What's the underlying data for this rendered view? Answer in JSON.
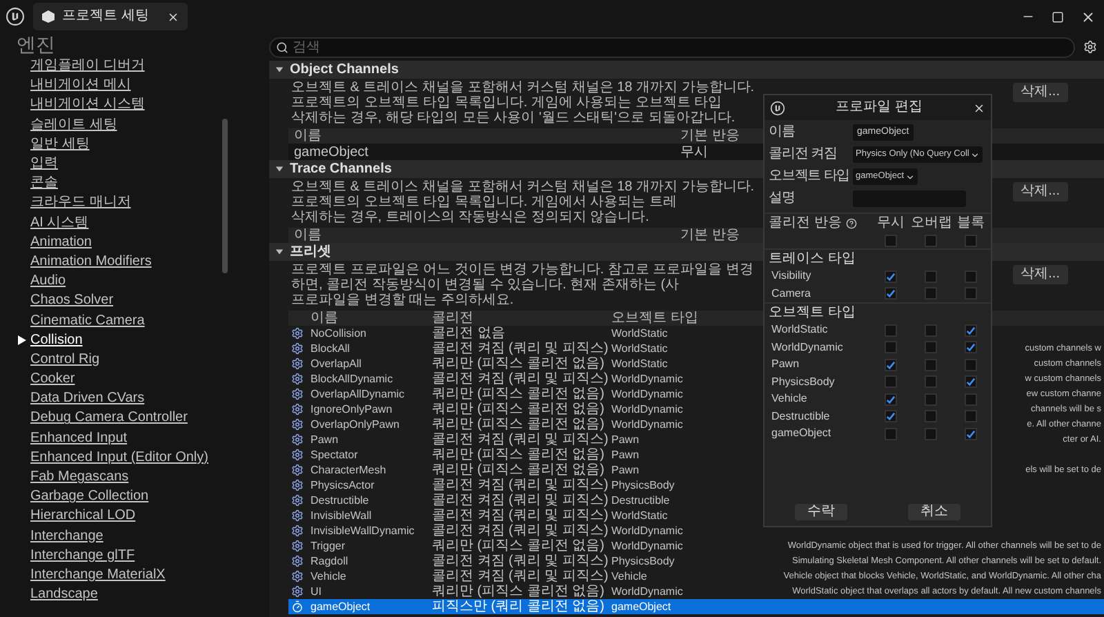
{
  "window": {
    "title": "프로젝트 세팅"
  },
  "sidebar": {
    "heading": "엔진",
    "items": [
      {
        "label": "게임플레이 디버거",
        "selected": false
      },
      {
        "label": "내비게이션 메시",
        "selected": false
      },
      {
        "label": "내비게이션 시스템",
        "selected": false
      },
      {
        "label": "슬레이트 세팅",
        "selected": false
      },
      {
        "label": "일반 세팅",
        "selected": false
      },
      {
        "label": "입력",
        "selected": false
      },
      {
        "label": "콘솔",
        "selected": false
      },
      {
        "label": "크라우드 매니저",
        "selected": false
      },
      {
        "label": "AI 시스템",
        "selected": false
      },
      {
        "label": "Animation",
        "selected": false
      },
      {
        "label": "Animation Modifiers",
        "selected": false
      },
      {
        "label": "Audio",
        "selected": false
      },
      {
        "label": "Chaos Solver",
        "selected": false
      },
      {
        "label": "Cinematic Camera",
        "selected": false
      },
      {
        "label": "Collision",
        "selected": true
      },
      {
        "label": "Control Rig",
        "selected": false
      },
      {
        "label": "Cooker",
        "selected": false
      },
      {
        "label": "Data Driven CVars",
        "selected": false
      },
      {
        "label": "Debug Camera Controller",
        "selected": false
      },
      {
        "label": "Enhanced Input",
        "selected": false
      },
      {
        "label": "Enhanced Input (Editor Only)",
        "selected": false
      },
      {
        "label": "Fab Megascans",
        "selected": false
      },
      {
        "label": "Garbage Collection",
        "selected": false
      },
      {
        "label": "Hierarchical LOD",
        "selected": false
      },
      {
        "label": "Interchange",
        "selected": false
      },
      {
        "label": "Interchange glTF",
        "selected": false
      },
      {
        "label": "Interchange MaterialX",
        "selected": false
      },
      {
        "label": "Landscape",
        "selected": false
      }
    ]
  },
  "search": {
    "placeholder": "검색"
  },
  "object_channels": {
    "title": "Object Channels",
    "expanded": true,
    "description": [
      "오브젝트 & 트레이스 채널을 포함해서 커스텀 채널은 18 개까지 가능합니다. 프로젝트의 오브젝트 타입 목록입니다. 게임에 사용되는 오브젝트 타입",
      "삭제하는 경우, 해당 타입의 모든 사용이 '월드 스태틱'으로 되돌아갑니다."
    ],
    "delete_button": "삭제...",
    "columns": [
      "이름",
      "기본 반응"
    ],
    "rows": [
      [
        "gameObject",
        "무시"
      ]
    ]
  },
  "trace_channels": {
    "title": "Trace Channels",
    "expanded": true,
    "description": [
      "오브젝트 & 트레이스 채널을 포함해서 커스텀 채널은 18 개까지 가능합니다. 프로젝트의 오브젝트 타입 목록입니다. 게임에서 사용되는 트레",
      "삭제하는 경우, 트레이스의 작동방식은 정의되지 않습니다."
    ],
    "delete_button": "삭제...",
    "columns": [
      "이름",
      "기본 반응"
    ]
  },
  "presets": {
    "title": "프리셋",
    "expanded": true,
    "description": [
      "프로젝트 프로파일은 어느 것이든 변경 가능합니다. 참고로 프로파일을 변경하면, 콜리전 작동방식이 변경될 수 있습니다. 현재 존재하는 (사",
      "프로파일을 변경할 때는 주의하세요."
    ],
    "delete_button": "삭제...",
    "columns": [
      "이름",
      "콜리전",
      "오브젝트 타입"
    ],
    "rows": [
      {
        "kind": "builtin",
        "name": "NoCollision",
        "collision": "콜리전 없음",
        "object_type": "WorldStatic",
        "selected": false
      },
      {
        "kind": "builtin",
        "name": "BlockAll",
        "collision": "콜리전 켜짐 (쿼리 및 피직스)",
        "object_type": "WorldStatic",
        "description": "custom channels w",
        "selected": false
      },
      {
        "kind": "builtin",
        "name": "OverlapAll",
        "collision": "쿼리만 (피직스 콜리전 없음)",
        "object_type": "WorldStatic",
        "description": "custom channels",
        "selected": false
      },
      {
        "kind": "builtin",
        "name": "BlockAllDynamic",
        "collision": "콜리전 켜짐 (쿼리 및 피직스)",
        "object_type": "WorldDynamic",
        "description": "w custom channels",
        "selected": false
      },
      {
        "kind": "builtin",
        "name": "OverlapAllDynamic",
        "collision": "쿼리만 (피직스 콜리전 없음)",
        "object_type": "WorldDynamic",
        "description": "ew custom channe",
        "selected": false
      },
      {
        "kind": "builtin",
        "name": "IgnoreOnlyPawn",
        "collision": "쿼리만 (피직스 콜리전 없음)",
        "object_type": "WorldDynamic",
        "description": "channels will be s",
        "selected": false
      },
      {
        "kind": "builtin",
        "name": "OverlapOnlyPawn",
        "collision": "쿼리만 (피직스 콜리전 없음)",
        "object_type": "WorldDynamic",
        "description": "e. All other channe",
        "selected": false
      },
      {
        "kind": "builtin",
        "name": "Pawn",
        "collision": "콜리전 켜짐 (쿼리 및 피직스)",
        "object_type": "Pawn",
        "description": "cter or AI.",
        "selected": false
      },
      {
        "kind": "builtin",
        "name": "Spectator",
        "collision": "쿼리만 (피직스 콜리전 없음)",
        "object_type": "Pawn",
        "selected": false
      },
      {
        "kind": "builtin",
        "name": "CharacterMesh",
        "collision": "쿼리만 (피직스 콜리전 없음)",
        "object_type": "Pawn",
        "description": "els will be set to de",
        "selected": false
      },
      {
        "kind": "builtin",
        "name": "PhysicsActor",
        "collision": "콜리전 켜짐 (쿼리 및 피직스)",
        "object_type": "PhysicsBody",
        "selected": false
      },
      {
        "kind": "builtin",
        "name": "Destructible",
        "collision": "콜리전 켜짐 (쿼리 및 피직스)",
        "object_type": "Destructible",
        "selected": false
      },
      {
        "kind": "builtin",
        "name": "InvisibleWall",
        "collision": "콜리전 켜짐 (쿼리 및 피직스)",
        "object_type": "WorldStatic",
        "selected": false
      },
      {
        "kind": "builtin",
        "name": "InvisibleWallDynamic",
        "collision": "콜리전 켜짐 (쿼리 및 피직스)",
        "object_type": "WorldDynamic",
        "selected": false
      },
      {
        "kind": "builtin",
        "name": "Trigger",
        "collision": "쿼리만 (피직스 콜리전 없음)",
        "object_type": "WorldDynamic",
        "description": "WorldDynamic object that is used for trigger. All other channels will be set to de",
        "selected": false
      },
      {
        "kind": "builtin",
        "name": "Ragdoll",
        "collision": "콜리전 켜짐 (쿼리 및 피직스)",
        "object_type": "PhysicsBody",
        "description": "Simulating Skeletal Mesh Component. All other channels will be set to default.",
        "selected": false
      },
      {
        "kind": "builtin",
        "name": "Vehicle",
        "collision": "콜리전 켜짐 (쿼리 및 피직스)",
        "object_type": "Vehicle",
        "description": "Vehicle object that blocks Vehicle, WorldStatic, and WorldDynamic. All other cha",
        "selected": false
      },
      {
        "kind": "builtin",
        "name": "UI",
        "collision": "쿼리만 (피직스 콜리전 없음)",
        "object_type": "WorldDynamic",
        "description": "WorldStatic object that overlaps all actors by default. All new custom channels",
        "selected": false
      },
      {
        "kind": "custom",
        "name": "gameObject",
        "collision": "피직스만 (쿼리 콜리전 없음)",
        "object_type": "gameObject",
        "selected": true
      }
    ]
  },
  "dialog": {
    "title": "프로파일 편집",
    "fields": [
      {
        "label": "이름",
        "kind": "text",
        "value": "gameObject"
      },
      {
        "label": "콜리전 켜짐",
        "kind": "dropdown",
        "value": "Physics Only (No Query Coll"
      },
      {
        "label": "오브젝트 타입",
        "kind": "dropdown",
        "value": "gameObject"
      },
      {
        "label": "설명",
        "kind": "text"
      }
    ],
    "response_label": "콜리전 반응",
    "response_columns": [
      "무시",
      "오버랩",
      "블록"
    ],
    "all": {
      "ignore": false,
      "overlap": false,
      "block": false
    },
    "groups": [
      {
        "title": "트레이스 타입",
        "rows": [
          {
            "name": "Visibility",
            "ignore": true,
            "overlap": false,
            "block": false
          },
          {
            "name": "Camera",
            "ignore": true,
            "overlap": false,
            "block": false
          }
        ]
      },
      {
        "title": "오브젝트 타입",
        "rows": [
          {
            "name": "WorldStatic",
            "ignore": false,
            "overlap": false,
            "block": true
          },
          {
            "name": "WorldDynamic",
            "ignore": false,
            "overlap": false,
            "block": true
          },
          {
            "name": "Pawn",
            "ignore": true,
            "overlap": false,
            "block": false
          },
          {
            "name": "PhysicsBody",
            "ignore": false,
            "overlap": false,
            "block": true
          },
          {
            "name": "Vehicle",
            "ignore": true,
            "overlap": false,
            "block": false
          },
          {
            "name": "Destructible",
            "ignore": true,
            "overlap": false,
            "block": false
          },
          {
            "name": "gameObject",
            "ignore": false,
            "overlap": false,
            "block": true
          }
        ]
      }
    ],
    "buttons": [
      "수락",
      "취소"
    ]
  }
}
